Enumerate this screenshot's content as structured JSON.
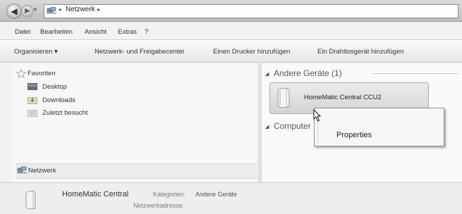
{
  "address_bar": {
    "back_icon": "back-arrow",
    "forward_icon": "forward-arrow",
    "crumb_separator": "▸",
    "breadcrumb_root_icon": "network-icon",
    "breadcrumb": [
      "Netzwerk"
    ]
  },
  "menu": {
    "items": [
      "Datei",
      "Bearbeiten",
      "Ansicht",
      "Extras",
      "?"
    ]
  },
  "commands": {
    "organize": "Organisieren ▾",
    "network_center": "Netzwerk- und Freigabecenter",
    "add_printer": "Einen Drucker hinzufügen",
    "add_wireless": "Ein Drahtlosgerät hinzufügen"
  },
  "nav": {
    "favorites_label": "Favoriten",
    "favorites": [
      "Desktop",
      "Downloads",
      "Zuletzt besucht"
    ],
    "network_label": "Netzwerk"
  },
  "content": {
    "groups": [
      {
        "label": "Andere Geräte (1)"
      },
      {
        "label": "Computer"
      }
    ],
    "device": {
      "name": "HomeMatic Central CCU2",
      "icon": "device-tower-icon"
    }
  },
  "context_menu": {
    "items": [
      "Properties"
    ]
  },
  "details": {
    "name": "HomeMatic Central",
    "category_key": "Kategorien:",
    "category_value": "Andere Geräte",
    "address_key": "Netzwerkadresse:",
    "address_value": ""
  },
  "colors": {
    "window_bg": "#f2f2f2",
    "tile_bg": "#d4d4d4",
    "text": "#333333"
  }
}
